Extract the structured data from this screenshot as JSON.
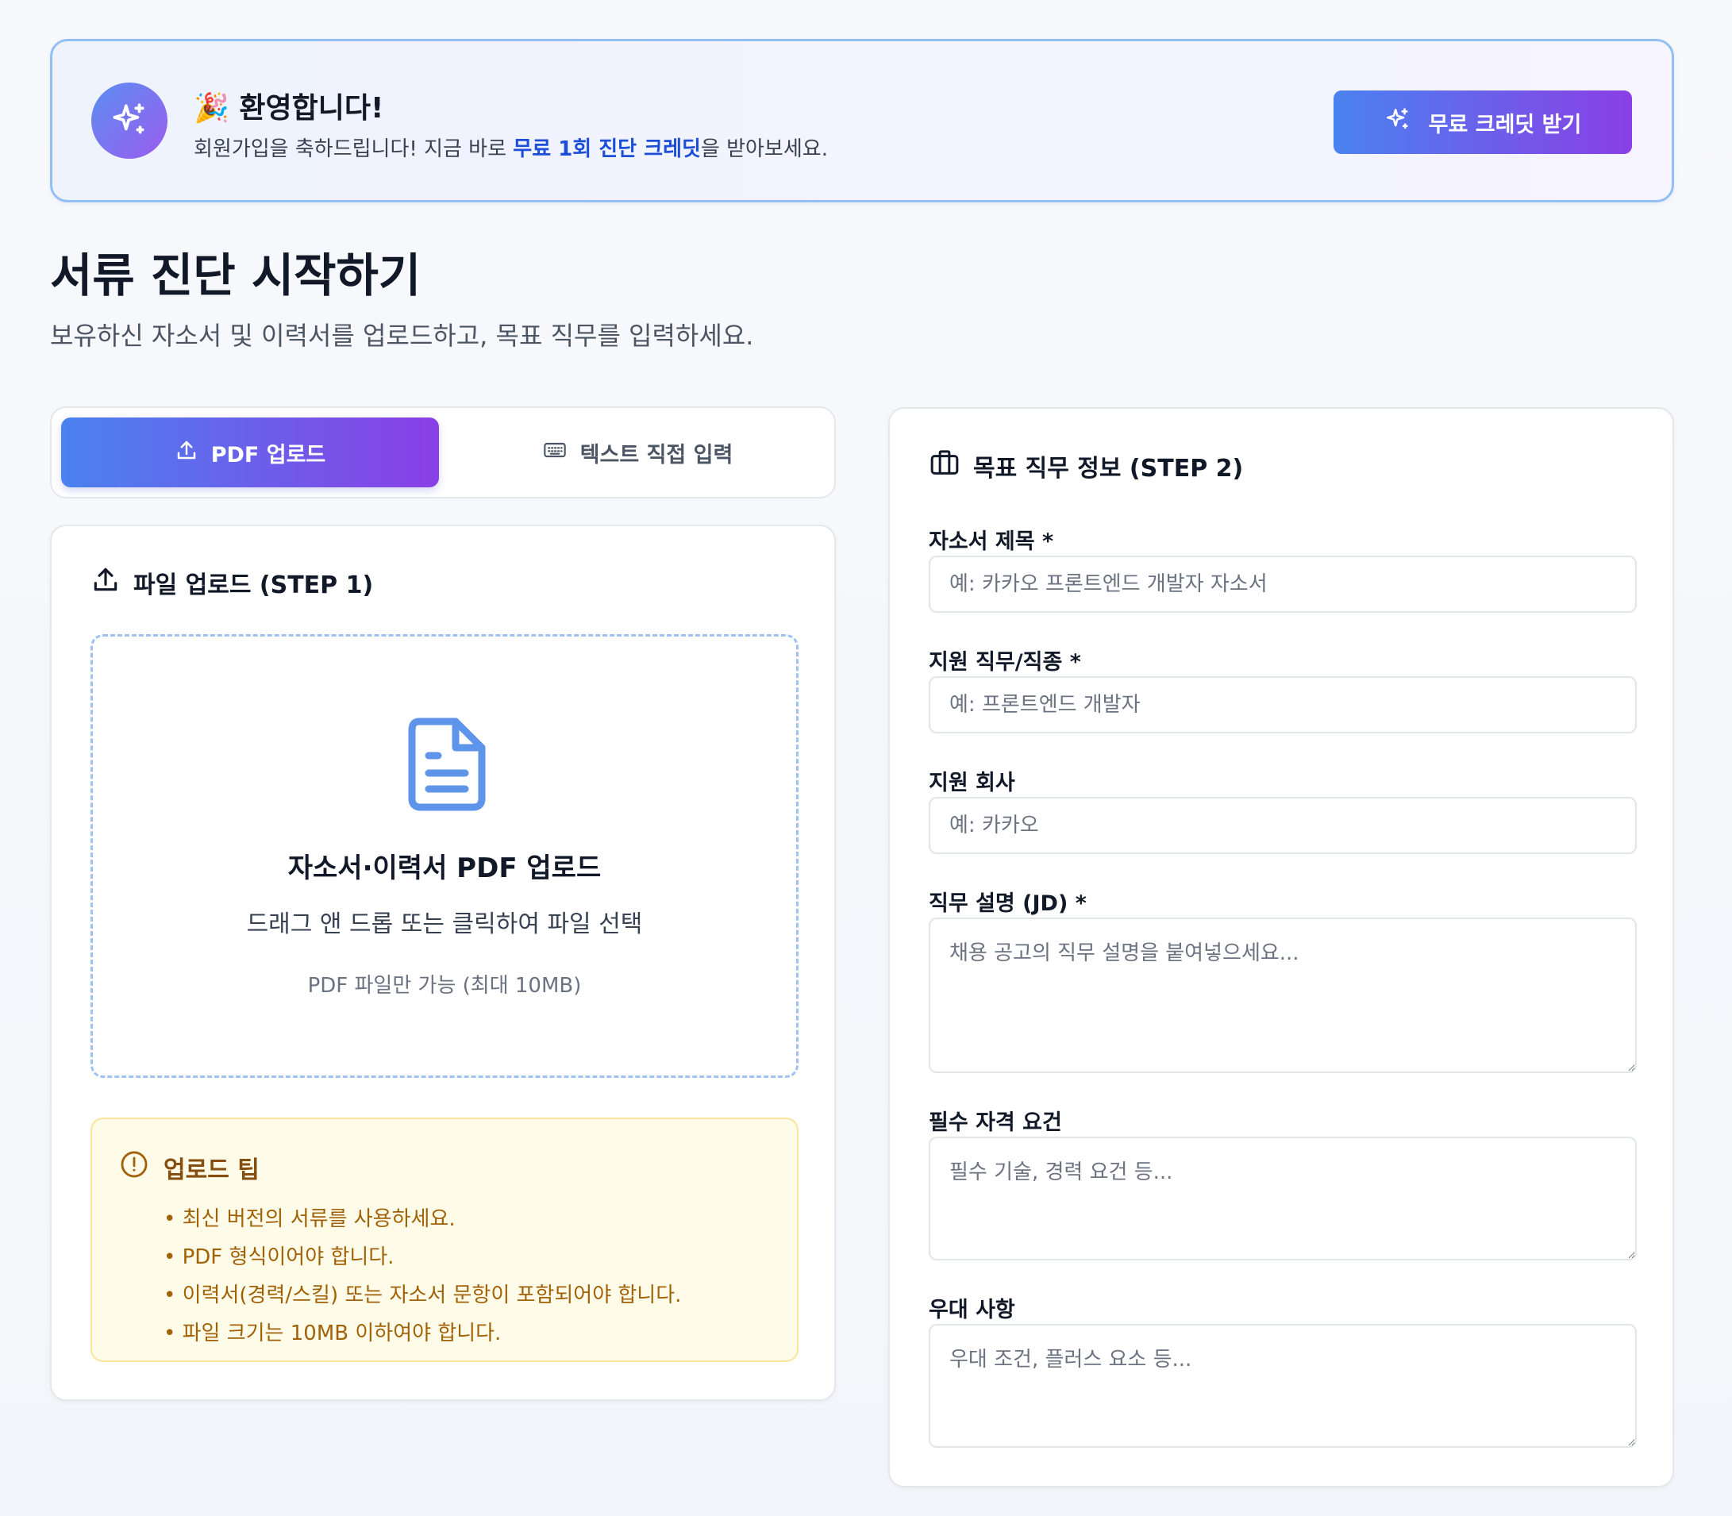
{
  "banner": {
    "emoji": "🎉",
    "title": "환영합니다!",
    "desc_before": "회원가입을 축하드립니다! 지금 바로 ",
    "desc_highlight": "무료 1회 진단 크레딧",
    "desc_after": "을 받아보세요.",
    "button_label": "무료 크레딧 받기"
  },
  "page": {
    "title": "서류 진단 시작하기",
    "subtitle": "보유하신 자소서 및 이력서를 업로드하고, 목표 직무를 입력하세요."
  },
  "tabs": [
    {
      "label": "PDF 업로드",
      "active": true
    },
    {
      "label": "텍스트 직접 입력",
      "active": false
    }
  ],
  "upload": {
    "heading": "파일 업로드 (STEP 1)",
    "dropzone_title": "자소서·이력서 PDF 업로드",
    "dropzone_sub": "드래그 앤 드롭 또는 클릭하여 파일 선택",
    "dropzone_note": "PDF 파일만 가능 (최대 10MB)"
  },
  "tips": {
    "heading": "업로드 팁",
    "items": [
      "최신 버전의 서류를 사용하세요.",
      "PDF 형식이어야 합니다.",
      "이력서(경력/스킬) 또는 자소서 문항이 포함되어야 합니다.",
      "파일 크기는 10MB 이하여야 합니다."
    ]
  },
  "job": {
    "heading": "목표 직무 정보 (STEP 2)",
    "fields": {
      "title": {
        "label": "자소서 제목 *",
        "placeholder": "예: 카카오 프론트엔드 개발자 자소서"
      },
      "role": {
        "label": "지원 직무/직종 *",
        "placeholder": "예: 프론트엔드 개발자"
      },
      "company": {
        "label": "지원 회사",
        "placeholder": "예: 카카오"
      },
      "jd": {
        "label": "직무 설명 (JD) *",
        "placeholder": "채용 공고의 직무 설명을 붙여넣으세요..."
      },
      "requirements": {
        "label": "필수 자격 요건",
        "placeholder": "필수 기술, 경력 요건 등..."
      },
      "preferred": {
        "label": "우대 사항",
        "placeholder": "우대 조건, 플러스 요소 등..."
      }
    }
  },
  "colors": {
    "accent_start": "#4a82ef",
    "accent_end": "#8a3fe6",
    "link": "#1d4ed8",
    "tip_text": "#a16207"
  }
}
